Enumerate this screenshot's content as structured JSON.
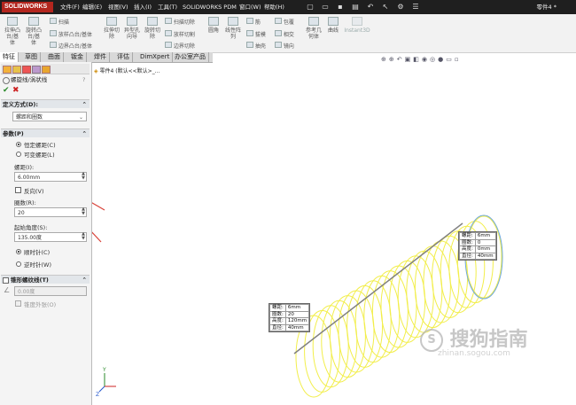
{
  "app": {
    "logo": "SOLIDWORKS",
    "document_title": "零件4 *"
  },
  "menus": [
    "文件(F)",
    "编辑(E)",
    "视图(V)",
    "插入(I)",
    "工具(T)",
    "SOLIDWORKS PDM",
    "窗口(W)",
    "帮助(H)"
  ],
  "ribbon": {
    "big": [
      {
        "label": "拉伸凸\n台/基\n体"
      },
      {
        "label": "旋转凸\n台/基\n体"
      }
    ],
    "col1": [
      "扫描",
      "放样凸台/基体",
      "边界凸台/基体"
    ],
    "col2": [
      {
        "label": "拉伸切\n除"
      },
      {
        "label": "异型孔\n向导"
      },
      {
        "label": "旋转切\n除"
      }
    ],
    "col3": [
      "扫描切除",
      "放样切割",
      "边界切除"
    ],
    "col4": [
      {
        "label": "圆角"
      },
      {
        "label": "线性阵\n列"
      }
    ],
    "col5": [
      "筋",
      "拔模",
      "抽壳"
    ],
    "col6": [
      "包覆",
      "相交",
      "镜向"
    ],
    "col7": [
      {
        "label": "参考几\n何体"
      },
      {
        "label": "曲线"
      },
      {
        "label": "Instant3D"
      }
    ]
  },
  "tabs": [
    "特征",
    "草图",
    "曲面",
    "钣金",
    "焊件",
    "评估",
    "DimXpert",
    "办公室产品"
  ],
  "panel": {
    "title": "螺旋线/涡状线",
    "define_header": "定义方式(D):",
    "define_value": "螺距和圈数",
    "params_header": "参数(P)",
    "radio_constant": "恒定螺距(C)",
    "radio_variable": "可变螺距(L)",
    "pitch_label": "螺距(I):",
    "pitch_value": "6.00mm",
    "reverse_label": "反向(V)",
    "revolutions_label": "圈数(R):",
    "revolutions_value": "20",
    "start_angle_label": "起始角度(S):",
    "start_angle_value": "135.00度",
    "cw_label": "顺时针(C)",
    "ccw_label": "逆时针(W)",
    "taper_header": "锥形螺纹线(T)",
    "taper_value": "0.00度",
    "taper_outward": "锥度外张(O)"
  },
  "viewport": {
    "tree_label": "零件4 (默认<<默认>_...",
    "callout_right": {
      "rows": [
        [
          "螺距:",
          "6mm"
        ],
        [
          "圈数:",
          "0"
        ],
        [
          "高度:",
          "0mm"
        ],
        [
          "直径:",
          "40mm"
        ]
      ]
    },
    "callout_left": {
      "rows": [
        [
          "螺距:",
          "6mm"
        ],
        [
          "圈数:",
          "20"
        ],
        [
          "高度:",
          "120mm"
        ],
        [
          "直径:",
          "40mm"
        ]
      ]
    },
    "watermark": "搜狗指南",
    "watermark_sub": "zhinan.sogou.com",
    "colors": {
      "helix": "#f2ee4a",
      "axis": "#808080",
      "arrow": "#d9433a",
      "circle": "#6fa8dc"
    }
  }
}
